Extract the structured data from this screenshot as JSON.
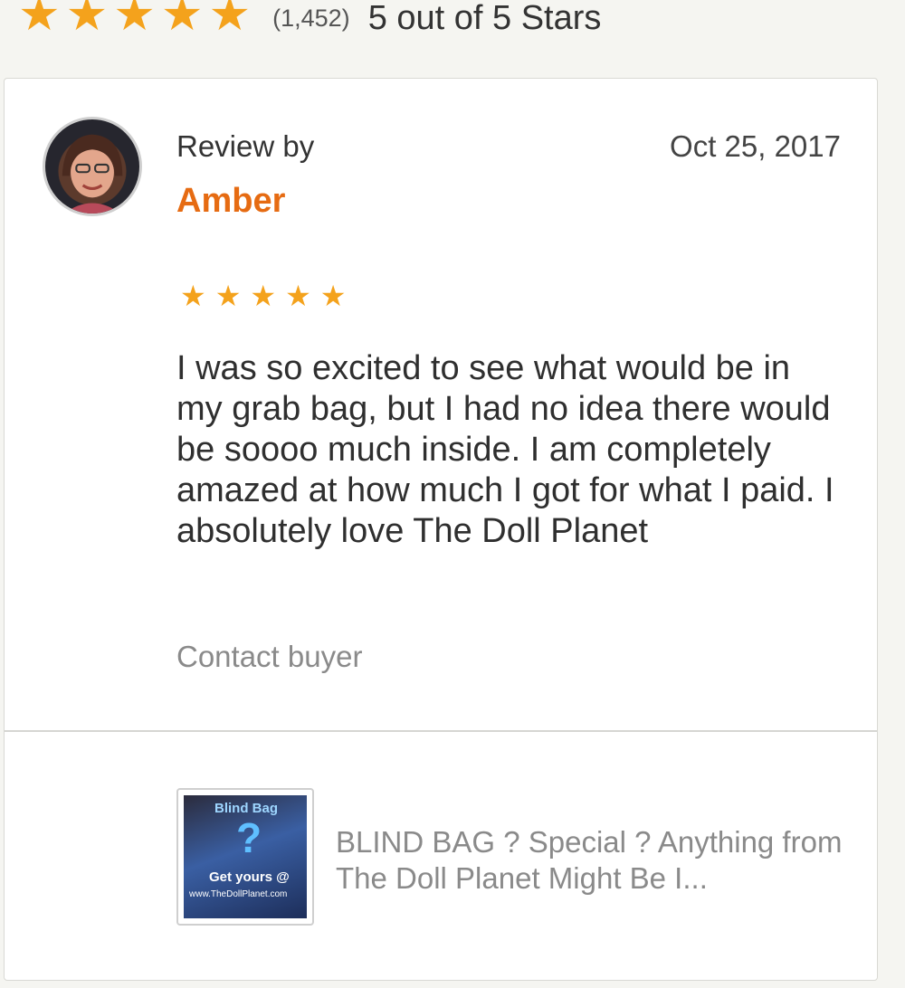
{
  "top_rating": {
    "stars_value": 5,
    "star_glyphs": [
      "★",
      "★",
      "★",
      "★",
      "★"
    ],
    "count": "(1,452)",
    "summary": "5 out of 5 Stars"
  },
  "review": {
    "label": "Review by",
    "reviewer": "Amber",
    "date": "Oct 25, 2017",
    "rating": 5,
    "star_glyphs": [
      "★",
      "★",
      "★",
      "★",
      "★"
    ],
    "text": "I was so excited to see what would be in my grab bag, but I had no idea there would be soooo much inside. I am completely amazed at how much I got for what I paid. I absolutely love The Doll Planet",
    "contact_label": "Contact buyer",
    "avatar_icon": "user-avatar-photo"
  },
  "product": {
    "thumbnail_text": {
      "top": "Blind Bag",
      "symbol": "?",
      "middle": "Get yours @",
      "url": "www.TheDollPlanet.com"
    },
    "title": "BLIND BAG ? Special ? Anything from The Doll Planet Might Be I..."
  },
  "colors": {
    "star": "#f4a21c",
    "reviewer_name": "#e66b12",
    "background": "#f5f5f1"
  }
}
